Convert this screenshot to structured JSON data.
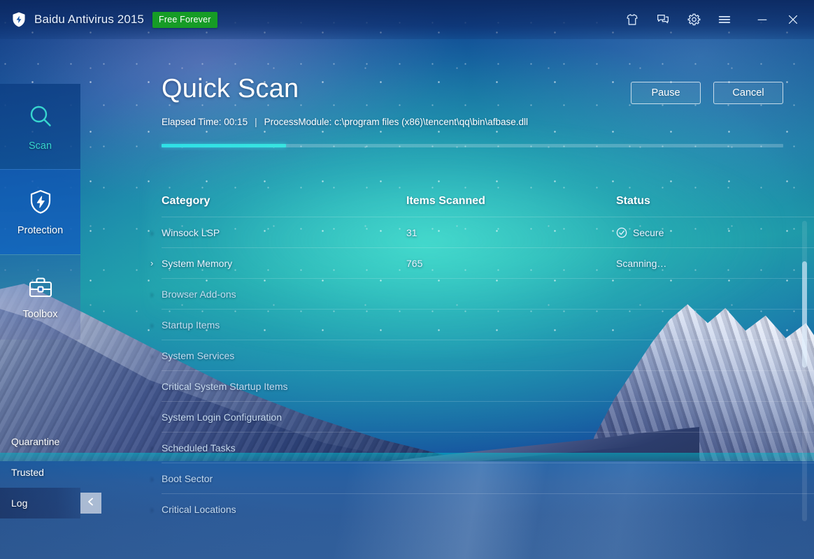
{
  "titlebar": {
    "logo_icon": "shield-bolt-icon",
    "title": "Baidu Antivirus 2015",
    "badge": "Free Forever",
    "icons": [
      {
        "name": "skin-icon",
        "label": "Skin"
      },
      {
        "name": "feedback-icon",
        "label": "Feedback"
      },
      {
        "name": "gear-icon",
        "label": "Settings"
      },
      {
        "name": "hamburger-menu-icon",
        "label": "Menu"
      },
      {
        "name": "minimize-icon",
        "label": "Minimize"
      },
      {
        "name": "close-icon",
        "label": "Close"
      }
    ]
  },
  "sidebar": {
    "items": [
      {
        "label": "Scan",
        "icon": "magnifier-icon",
        "active": true
      },
      {
        "label": "Protection",
        "icon": "shield-bolt-icon",
        "active": false
      },
      {
        "label": "Toolbox",
        "icon": "toolbox-icon",
        "active": false
      }
    ],
    "sub_items": [
      {
        "label": "Quarantine"
      },
      {
        "label": "Trusted"
      },
      {
        "label": "Log"
      }
    ],
    "collapse_button": {
      "icon": "chevron-left-icon",
      "label": "<"
    }
  },
  "main": {
    "title": "Quick Scan",
    "actions": [
      {
        "label": "Pause",
        "name": "pause-button"
      },
      {
        "label": "Cancel",
        "name": "cancel-button"
      }
    ],
    "meta": {
      "elapsed_label": "Elapsed Time: 00:15",
      "separator": "|",
      "process_module": "ProcessModule: c:\\program files (x86)\\tencent\\qq\\bin\\afbase.dll"
    },
    "progress_percent": 20,
    "table": {
      "headers": {
        "category": "Category",
        "items_scanned": "Items Scanned",
        "status": "Status"
      },
      "rows": [
        {
          "expander": "",
          "category": "Winsock LSP",
          "items": "31",
          "status": "Secure",
          "status_icon": "check-circle-icon",
          "state": "done"
        },
        {
          "expander": "›",
          "category": "System Memory",
          "items": "765",
          "status": "Scanning…",
          "status_icon": "",
          "state": "active"
        },
        {
          "expander": "",
          "category": "Browser Add-ons",
          "items": "",
          "status": "",
          "status_icon": "",
          "state": "pending"
        },
        {
          "expander": "",
          "category": "Startup Items",
          "items": "",
          "status": "",
          "status_icon": "",
          "state": "pending"
        },
        {
          "expander": "",
          "category": "System Services",
          "items": "",
          "status": "",
          "status_icon": "",
          "state": "pending"
        },
        {
          "expander": "",
          "category": "Critical System Startup Items",
          "items": "",
          "status": "",
          "status_icon": "",
          "state": "pending"
        },
        {
          "expander": "",
          "category": "System Login Configuration",
          "items": "",
          "status": "",
          "status_icon": "",
          "state": "pending"
        },
        {
          "expander": "",
          "category": "Scheduled Tasks",
          "items": "",
          "status": "",
          "status_icon": "",
          "state": "pending"
        },
        {
          "expander": "",
          "category": "Boot Sector",
          "items": "",
          "status": "",
          "status_icon": "",
          "state": "pending"
        },
        {
          "expander": "",
          "category": "Critical Locations",
          "items": "",
          "status": "",
          "status_icon": "",
          "state": "pending"
        }
      ]
    }
  },
  "colors": {
    "badge_green": "#169c26",
    "accent_cyan": "#37d6cf",
    "progress_cyan": "#2fe0e6",
    "titlebar_blue": "#0b2860",
    "text_white": "#ffffff"
  }
}
